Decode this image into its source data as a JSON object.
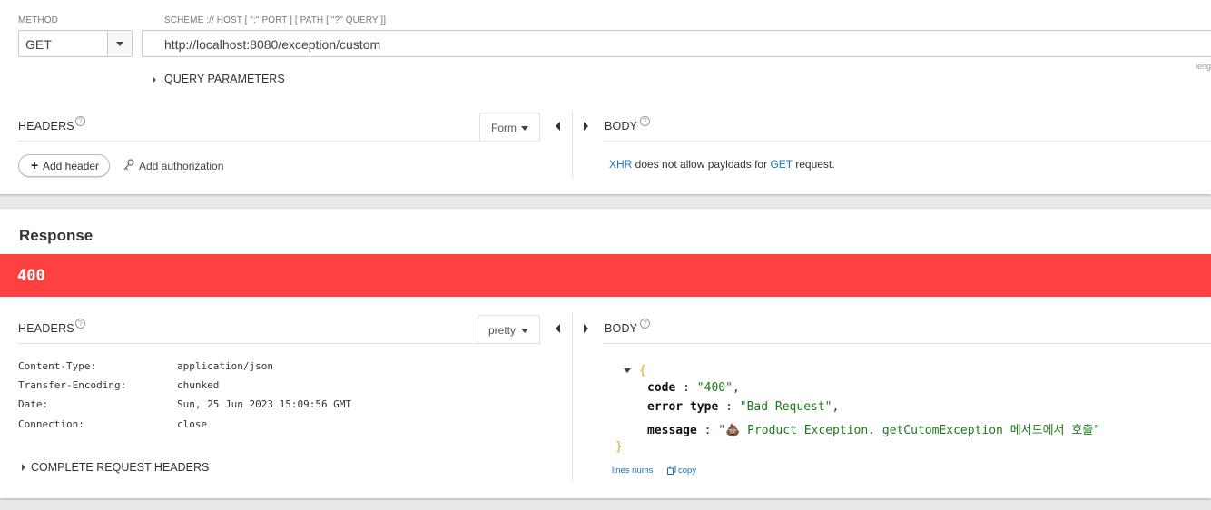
{
  "request": {
    "method_label": "METHOD",
    "method_value": "GET",
    "url_label": "SCHEME :// HOST [ \":\" PORT ] [ PATH [ \"?\" QUERY ]]",
    "url_value": "http://localhost:8080/exception/custom",
    "length_label": "leng",
    "query_params_label": "QUERY PARAMETERS",
    "headers_title": "HEADERS",
    "headers_mode": "Form",
    "add_header_label": "Add header",
    "add_authorization_label": "Add authorization",
    "body_title": "BODY",
    "body_note": {
      "xhr": "XHR",
      "mid": " does not allow payloads for ",
      "method": "GET",
      "end": " request."
    }
  },
  "response": {
    "title": "Response",
    "status_code": "400",
    "status_color": "#ff4040",
    "headers_title": "HEADERS",
    "headers_mode": "pretty",
    "headers": [
      {
        "name": "Content-Type:",
        "value": "application/json"
      },
      {
        "name": "Transfer-Encoding:",
        "value": "chunked"
      },
      {
        "name": "Date:",
        "value": "Sun, 25 Jun 2023 15:09:56 GMT"
      },
      {
        "name": "Connection:",
        "value": "close"
      }
    ],
    "complete_request_headers_label": "COMPLETE REQUEST HEADERS",
    "body_title": "BODY",
    "body_json": {
      "open_brace": "{",
      "close_brace": "}",
      "fields": [
        {
          "key": "code",
          "value": "\"400\"",
          "trail": ","
        },
        {
          "key": "error type",
          "value": "\"Bad Request\"",
          "trail": ","
        },
        {
          "key": "message",
          "value": "\"💩 Product Exception. getCutomException 메서드에서 호출\"",
          "trail": ""
        }
      ]
    },
    "lines_nums_label": "lines nums",
    "copy_label": "copy"
  },
  "icons": [
    "caret-down-icon",
    "caret-right-icon",
    "help-icon",
    "plus-icon",
    "key-icon",
    "copy-icon",
    "collapse-left-icon",
    "expand-right-icon"
  ]
}
